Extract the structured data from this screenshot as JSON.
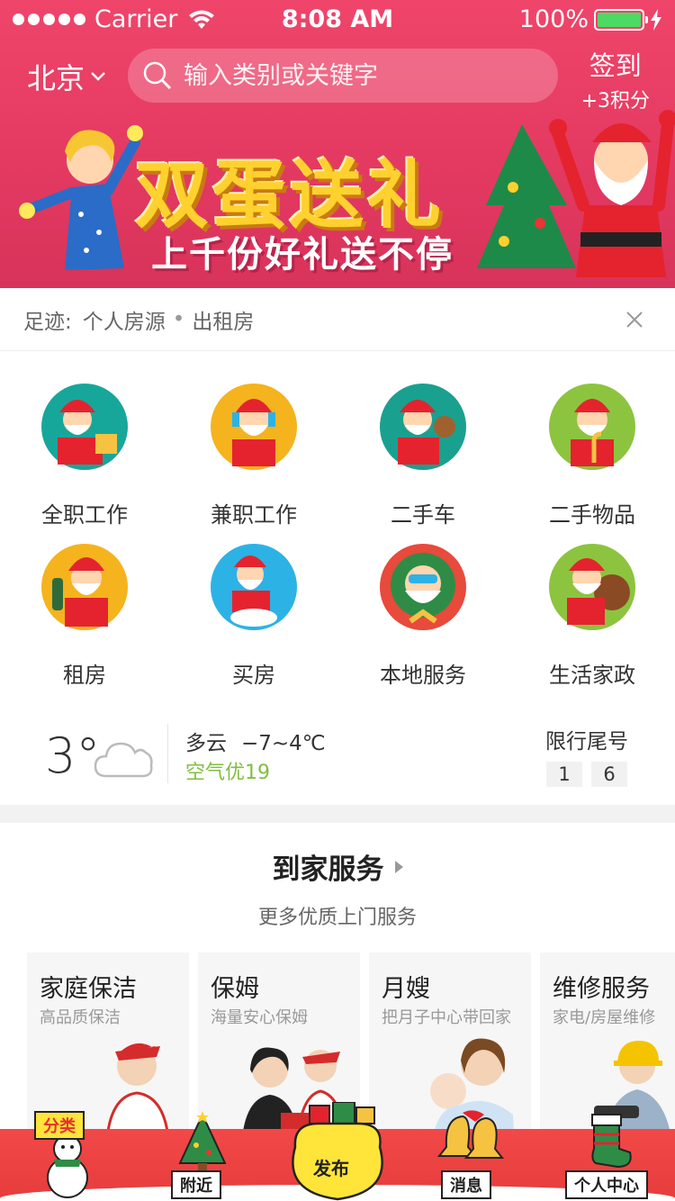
{
  "status_bar": {
    "carrier": "Carrier",
    "time": "8:08 AM",
    "battery": "100%"
  },
  "header": {
    "city": "北京",
    "search_placeholder": "输入类别或关键字",
    "checkin_label": "签到",
    "checkin_points": "+3积分"
  },
  "banner": {
    "title": "双蛋送礼",
    "subtitle": "上千份好礼送不停"
  },
  "footprint": {
    "label": "足迹:",
    "items": [
      "个人房源",
      "出租房"
    ]
  },
  "categories": [
    {
      "label": "全职工作",
      "icon": "santa-gift-icon",
      "bg": "#17a79a"
    },
    {
      "label": "兼职工作",
      "icon": "santa-headphones-icon",
      "bg": "#f5b31e"
    },
    {
      "label": "二手车",
      "icon": "santa-reindeer-icon",
      "bg": "#1aa08f"
    },
    {
      "label": "二手物品",
      "icon": "santa-candy-cane-icon",
      "bg": "#8cc43f"
    },
    {
      "label": "租房",
      "icon": "santa-champagne-icon",
      "bg": "#f5b31e"
    },
    {
      "label": "买房",
      "icon": "santa-scooter-icon",
      "bg": "#2db2e5"
    },
    {
      "label": "本地服务",
      "icon": "santa-wreath-icon",
      "bg": "#e84a3b"
    },
    {
      "label": "生活家政",
      "icon": "santa-sack-icon",
      "bg": "#8cc43f"
    }
  ],
  "weather": {
    "temp": "3°",
    "condition": "多云",
    "range": "−7~4℃",
    "air": "空气优19",
    "limit_label": "限行尾号",
    "limit_numbers": [
      "1",
      "6"
    ]
  },
  "home_service": {
    "title": "到家服务",
    "subtitle": "更多优质上门服务",
    "cards": [
      {
        "title": "家庭保洁",
        "sub": "高品质保洁"
      },
      {
        "title": "保姆",
        "sub": "海量安心保姆"
      },
      {
        "title": "月嫂",
        "sub": "把月子中心带回家"
      },
      {
        "title": "维修服务",
        "sub": "家电/房屋维修"
      }
    ]
  },
  "tabbar": {
    "classify": "分类",
    "nearby": "附近",
    "publish": "发布",
    "messages": "消息",
    "profile": "个人中心"
  },
  "colors": {
    "brand_red": "#e63c3c",
    "header_pink": "#f0456a",
    "air_green": "#7fbf3f"
  }
}
